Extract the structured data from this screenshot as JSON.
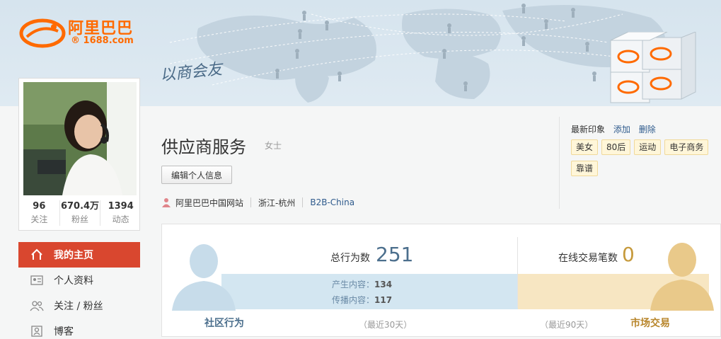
{
  "brand": {
    "name_cn": "阿里巴巴",
    "domain": "1688.com",
    "registered_mark": "®",
    "slogan": "以商会友",
    "accent": "#ff6a00"
  },
  "profile": {
    "title": "供应商服务",
    "gender": "女士",
    "edit_button": "编辑个人信息",
    "site": "阿里巴巴中国网站",
    "location": "浙江-杭州",
    "type": "B2B-China",
    "stats": [
      {
        "num": "96",
        "label": "关注"
      },
      {
        "num": "670.4万",
        "label": "粉丝"
      },
      {
        "num": "1394",
        "label": "动态"
      }
    ]
  },
  "nav": {
    "items": [
      {
        "label": "我的主页",
        "icon": "home-icon"
      },
      {
        "label": "个人资料",
        "icon": "profile-card-icon"
      },
      {
        "label": "关注 / 粉丝",
        "icon": "users-icon"
      },
      {
        "label": "博客",
        "icon": "blog-icon"
      }
    ],
    "active_color": "#d9472f"
  },
  "impressions": {
    "heading": "最新印象",
    "add": "添加",
    "delete": "删除",
    "tags": [
      "美女",
      "80后",
      "运动",
      "电子商务",
      "靠谱"
    ]
  },
  "activity": {
    "total_label": "总行为数",
    "total_value": "251",
    "produced_label": "产生内容：",
    "produced_value": "134",
    "spread_label": "传播内容：",
    "spread_value": "117",
    "community_caption": "社区行为",
    "community_period": "（最近30天）",
    "trade_label": "在线交易笔数",
    "trade_value": "0",
    "trade_caption": "市场交易",
    "trade_period": "（最近90天）"
  }
}
